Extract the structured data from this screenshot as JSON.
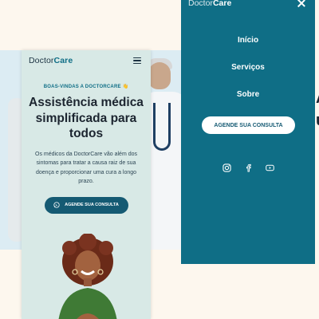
{
  "phone": {
    "logo_prefix": "Doctor",
    "logo_suffix": "Care",
    "welcome": "BOAS-VINDAS A DOCTORCARE 👋",
    "title": "Assistência médica simplificada para todos",
    "description": "Os médicos da DoctorCare vão além dos sintomas para tratar a causa raiz de sua doença e proporcionar uma cura a longo prazo.",
    "cta_label": "AGENDE SUA CONSULTA"
  },
  "menu": {
    "logo_prefix": "Doctor",
    "logo_suffix": "Care",
    "items": [
      {
        "label": "Início"
      },
      {
        "label": "Serviços"
      },
      {
        "label": "Sobre"
      }
    ],
    "cta_label": "AGENDE SUA CONSULTA",
    "socials": [
      "instagram-icon",
      "facebook-icon",
      "youtube-icon"
    ]
  },
  "colors": {
    "page_bg": "#fdf7ee",
    "teal": "#0f6e86",
    "mint": "#d8e9e6",
    "button": "#155a73"
  }
}
